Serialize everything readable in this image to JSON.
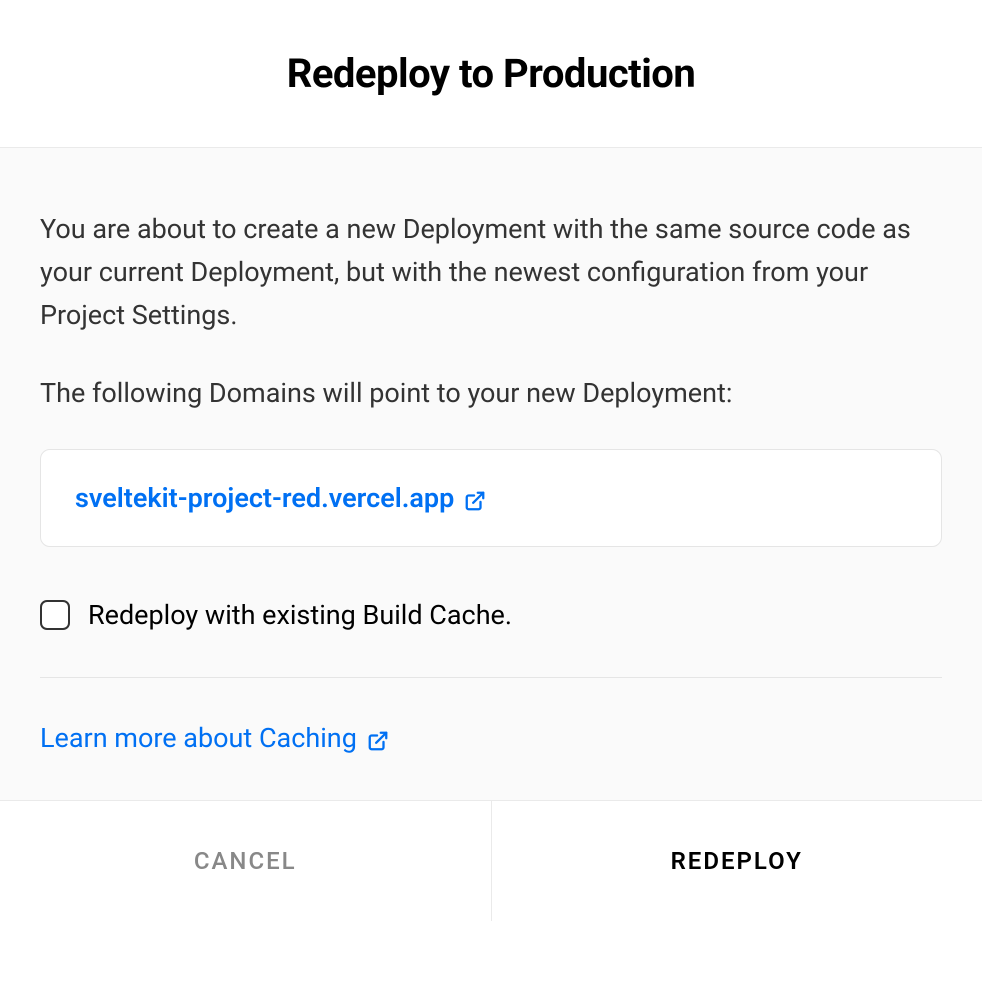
{
  "header": {
    "title": "Redeploy to Production"
  },
  "body": {
    "description": "You are about to create a new Deployment with the same source code as your current Deployment, but with the newest configuration from your Project Settings.",
    "domains_intro": "The following Domains will point to your new Deployment:",
    "domain": "sveltekit-project-red.vercel.app",
    "checkbox_label": "Redeploy with existing Build Cache.",
    "learn_more": "Learn more about Caching"
  },
  "footer": {
    "cancel": "CANCEL",
    "redeploy": "REDEPLOY"
  }
}
